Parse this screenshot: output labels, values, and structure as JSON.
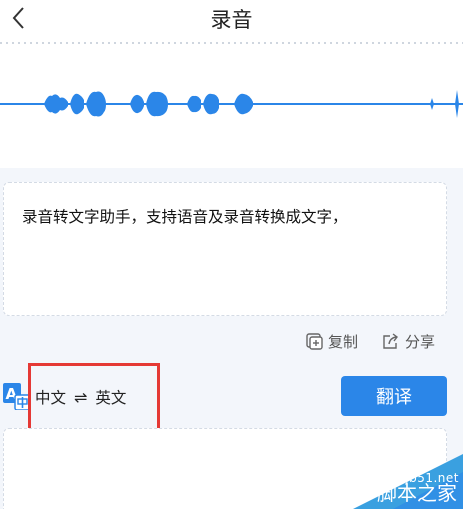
{
  "header": {
    "title": "录音"
  },
  "recognized_text": "录音转文字助手，支持语音及录音转换成文字，",
  "actions": {
    "copy_label": "复制",
    "share_label": "分享"
  },
  "language": {
    "source": "中文",
    "swap_symbol": "⇌",
    "target": "英文"
  },
  "translate_button": {
    "label": "翻译"
  },
  "watermark": {
    "url": "jb51.net",
    "name": "脚本之家"
  },
  "colors": {
    "accent": "#2b86e8",
    "highlight_box": "#e53935",
    "watermark": "#3aa0e0"
  }
}
